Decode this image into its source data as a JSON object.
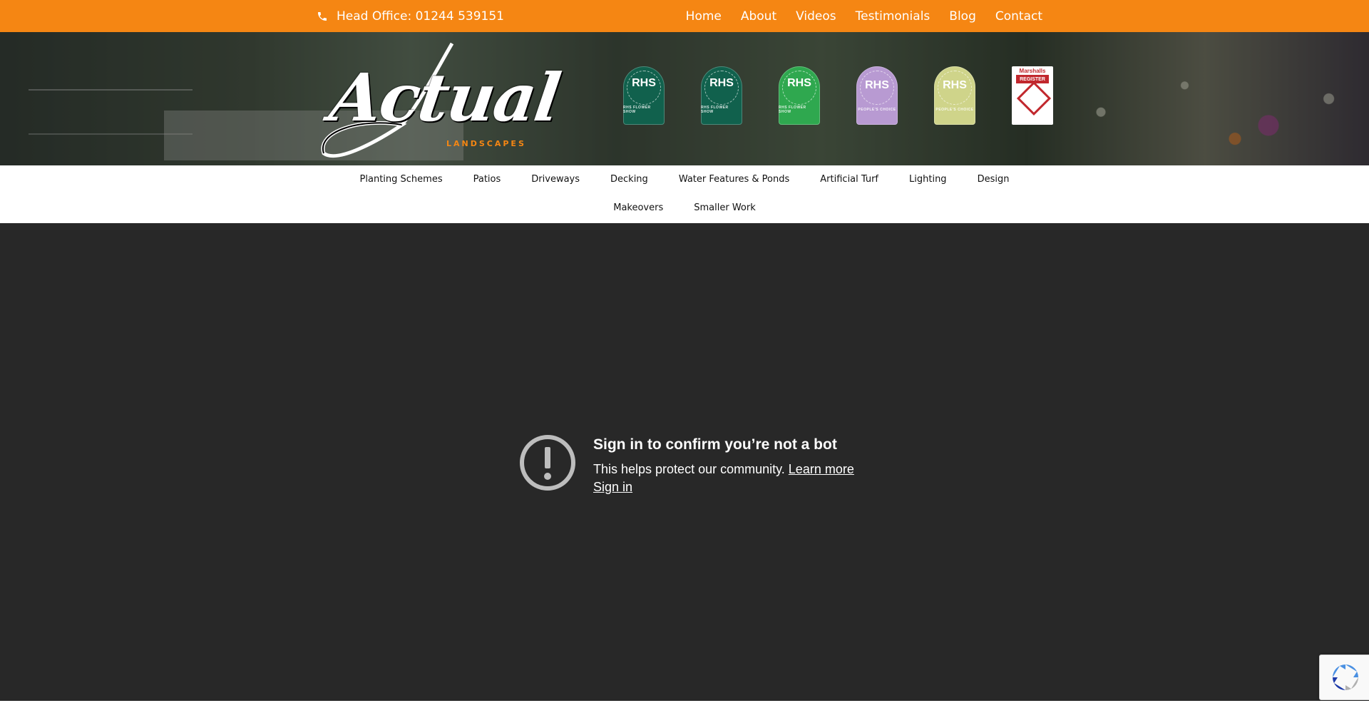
{
  "topbar": {
    "phone_label": "Head Office: 01244 539151",
    "nav": [
      "Home",
      "About",
      "Videos",
      "Testimonials",
      "Blog",
      "Contact"
    ],
    "bg_color": "#f58613"
  },
  "logo": {
    "script": "Actual",
    "sub": "LANDSCAPES"
  },
  "badges": [
    {
      "label": "RHS",
      "color": "#11614d"
    },
    {
      "label": "RHS",
      "color": "#11614d"
    },
    {
      "label": "RHS",
      "color": "#2fa84f"
    },
    {
      "label": "RHS",
      "color": "#b89ad2"
    },
    {
      "label": "RHS",
      "color": "#cfd48a"
    },
    {
      "label": "REGISTER",
      "top": "Marshalls",
      "color": "#c1272d"
    }
  ],
  "categories": {
    "row1": [
      "Planting Schemes",
      "Patios",
      "Driveways",
      "Decking",
      "Water Features & Ponds",
      "Artificial Turf",
      "Lighting",
      "Design"
    ],
    "row2": [
      "Makeovers",
      "Smaller Work"
    ]
  },
  "video_notice": {
    "title": "Sign in to confirm you’re not a bot",
    "description": "This helps protect our community.",
    "learn_more": "Learn more",
    "sign_in": "Sign in"
  }
}
